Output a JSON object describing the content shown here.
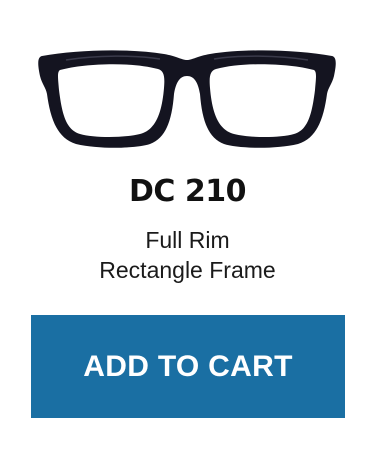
{
  "product": {
    "name": "DC 210",
    "description_line1": "Full Rim",
    "description_line2": "Rectangle Frame",
    "image_icon": "eyeglasses-frame-icon",
    "frame_color": "#141420"
  },
  "actions": {
    "add_to_cart_label": "ADD TO CART",
    "button_color": "#1a6fa3"
  }
}
